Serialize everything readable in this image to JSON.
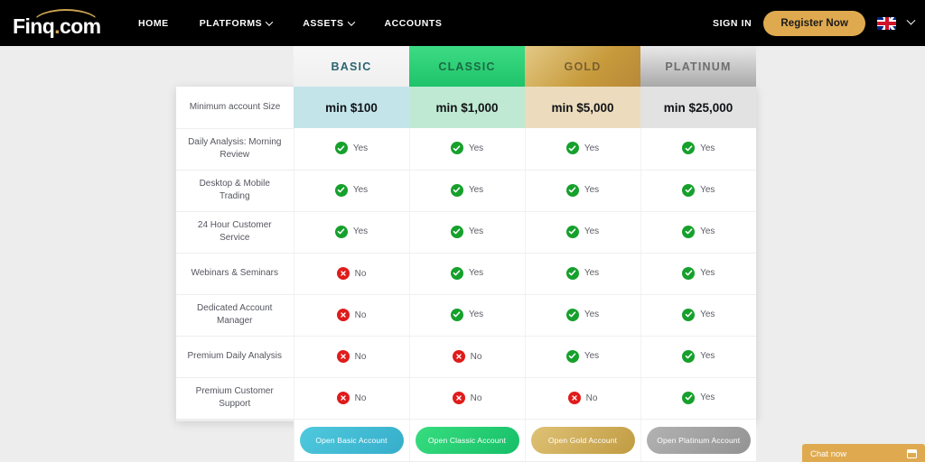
{
  "navbar": {
    "logo_text": "Finq",
    "logo_dot": ".",
    "logo_suffix": "com",
    "links": [
      {
        "label": "HOME",
        "has_caret": false
      },
      {
        "label": "PLATFORMS",
        "has_caret": true
      },
      {
        "label": "ASSETS",
        "has_caret": true
      },
      {
        "label": "ACCOUNTS",
        "has_caret": false
      }
    ],
    "sign_in_label": "SIGN IN",
    "register_label": "Register Now",
    "register_color": "#dfaa4f",
    "flag_icon": "uk-flag-icon",
    "lang_caret_icon": "chevron-down-icon"
  },
  "table": {
    "plans": [
      {
        "name": "BASIC",
        "price": "min $100",
        "cta": "Open Basic Account",
        "accent": "#36aecb"
      },
      {
        "name": "CLASSIC",
        "price": "min $1,000",
        "cta": "Open Classic Account",
        "accent": "#16bf68"
      },
      {
        "name": "GOLD",
        "price": "min $5,000",
        "cta": "Open Gold Account",
        "accent": "#c09b41"
      },
      {
        "name": "PLATINUM",
        "price": "min $25,000",
        "cta": "Open Platinum Account",
        "accent": "#939393"
      }
    ],
    "price_row_label": "Minimum account Size",
    "features": [
      {
        "label": "Daily Analysis: Morning Review",
        "values": [
          "Yes",
          "Yes",
          "Yes",
          "Yes"
        ]
      },
      {
        "label": "Desktop & Mobile Trading",
        "values": [
          "Yes",
          "Yes",
          "Yes",
          "Yes"
        ]
      },
      {
        "label": "24 Hour Customer Service",
        "values": [
          "Yes",
          "Yes",
          "Yes",
          "Yes"
        ]
      },
      {
        "label": "Webinars & Seminars",
        "values": [
          "No",
          "Yes",
          "Yes",
          "Yes"
        ]
      },
      {
        "label": "Dedicated Account Manager",
        "values": [
          "No",
          "Yes",
          "Yes",
          "Yes"
        ]
      },
      {
        "label": "Premium Daily Analysis",
        "values": [
          "No",
          "No",
          "Yes",
          "Yes"
        ]
      },
      {
        "label": "Premium Customer Support",
        "values": [
          "No",
          "No",
          "No",
          "Yes"
        ]
      }
    ],
    "yes_color": "#16a02c",
    "no_color": "#e01b1b"
  },
  "chat": {
    "label": "Chat now",
    "icon": "chat-window-icon",
    "color": "#dfaa4f"
  }
}
